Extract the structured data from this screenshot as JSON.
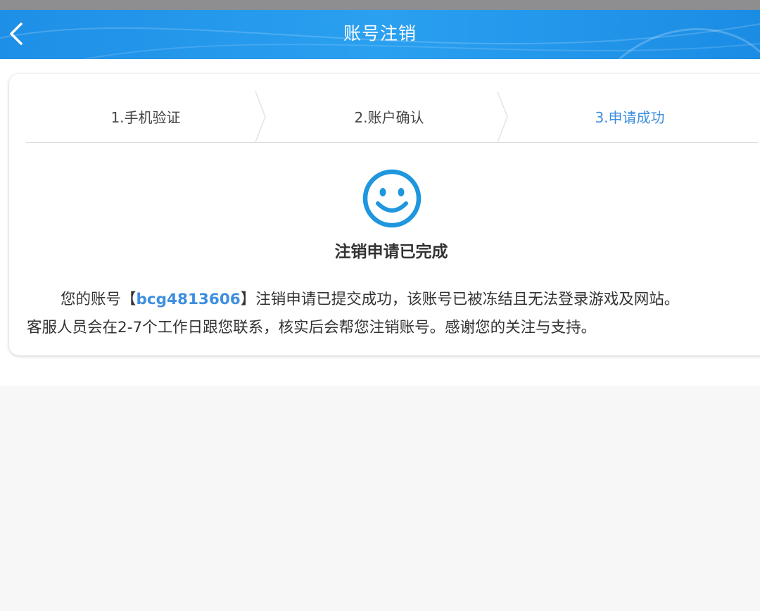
{
  "header": {
    "title": "账号注销",
    "back_icon": "chevron-left-icon"
  },
  "steps": [
    {
      "label": "1.手机验证",
      "active": false
    },
    {
      "label": "2.账户确认",
      "active": false
    },
    {
      "label": "3.申请成功",
      "active": true
    }
  ],
  "result": {
    "icon": "smiley-face-icon",
    "title": "注销申请已完成",
    "message_prefix": "您的账号【",
    "account": "bcg4813606",
    "message_mid": "】注销申请已提交成功，该账号已被冻结且无法登录游戏及网站。",
    "message_line2": "客服人员会在2-7个工作日跟您联系，核实后会帮您注销账号。感谢您的关注与支持。"
  },
  "colors": {
    "header_blue": "#1e8fe6",
    "accent_blue": "#3e8fe0",
    "icon_blue": "#1f96de"
  }
}
